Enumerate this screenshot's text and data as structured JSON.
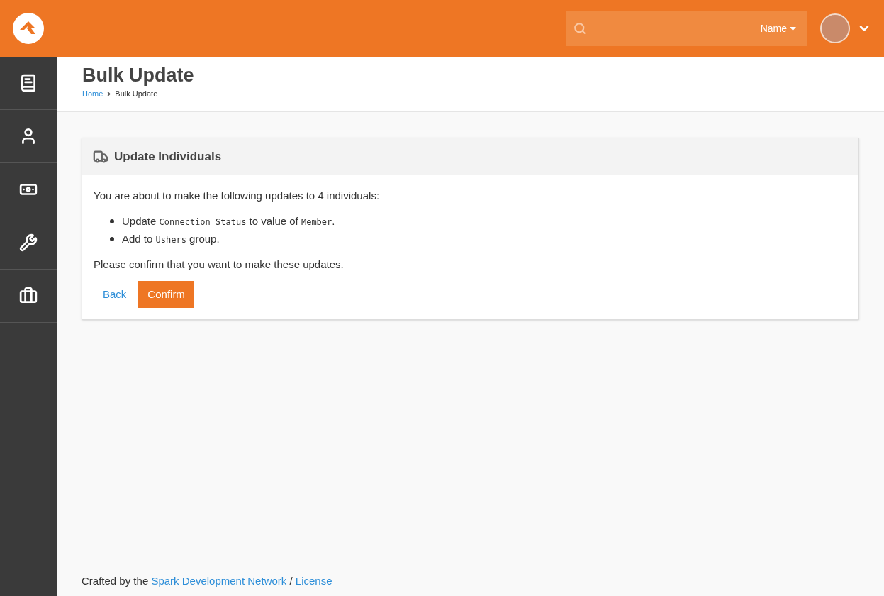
{
  "header": {
    "search": {
      "filter": "Name"
    }
  },
  "sidebar": {
    "items": [
      {
        "kind": "book"
      },
      {
        "kind": "person"
      },
      {
        "kind": "money"
      },
      {
        "kind": "wrench"
      },
      {
        "kind": "briefcase"
      }
    ]
  },
  "page": {
    "title": "Bulk Update",
    "breadcrumbs": [
      {
        "label": "Home",
        "link": true
      },
      {
        "label": "Bulk Update",
        "link": false
      }
    ]
  },
  "panel": {
    "title": "Update Individuals",
    "intro": "You are about to make the following updates to 4 individuals:",
    "updates": [
      [
        {
          "kind": "text",
          "text": "Update"
        },
        {
          "kind": "code",
          "text": "Connection Status"
        },
        {
          "kind": "text",
          "text": "to value of"
        },
        {
          "kind": "code",
          "text": "Member"
        },
        {
          "kind": "text",
          "text": "."
        }
      ],
      [
        {
          "kind": "text",
          "text": "Add to"
        },
        {
          "kind": "code",
          "text": "Ushers"
        },
        {
          "kind": "text",
          "text": "group."
        }
      ]
    ],
    "confirm_text": "Please confirm that you want to make these updates.",
    "buttons": [
      {
        "kind": "link",
        "label": "Back"
      },
      {
        "kind": "primary",
        "label": "Confirm"
      }
    ]
  },
  "footer": [
    {
      "kind": "text",
      "text": "Crafted by the"
    },
    {
      "kind": "link",
      "text": "Spark Development Network"
    },
    {
      "kind": "text",
      "text": "/"
    },
    {
      "kind": "link",
      "text": "License"
    }
  ]
}
